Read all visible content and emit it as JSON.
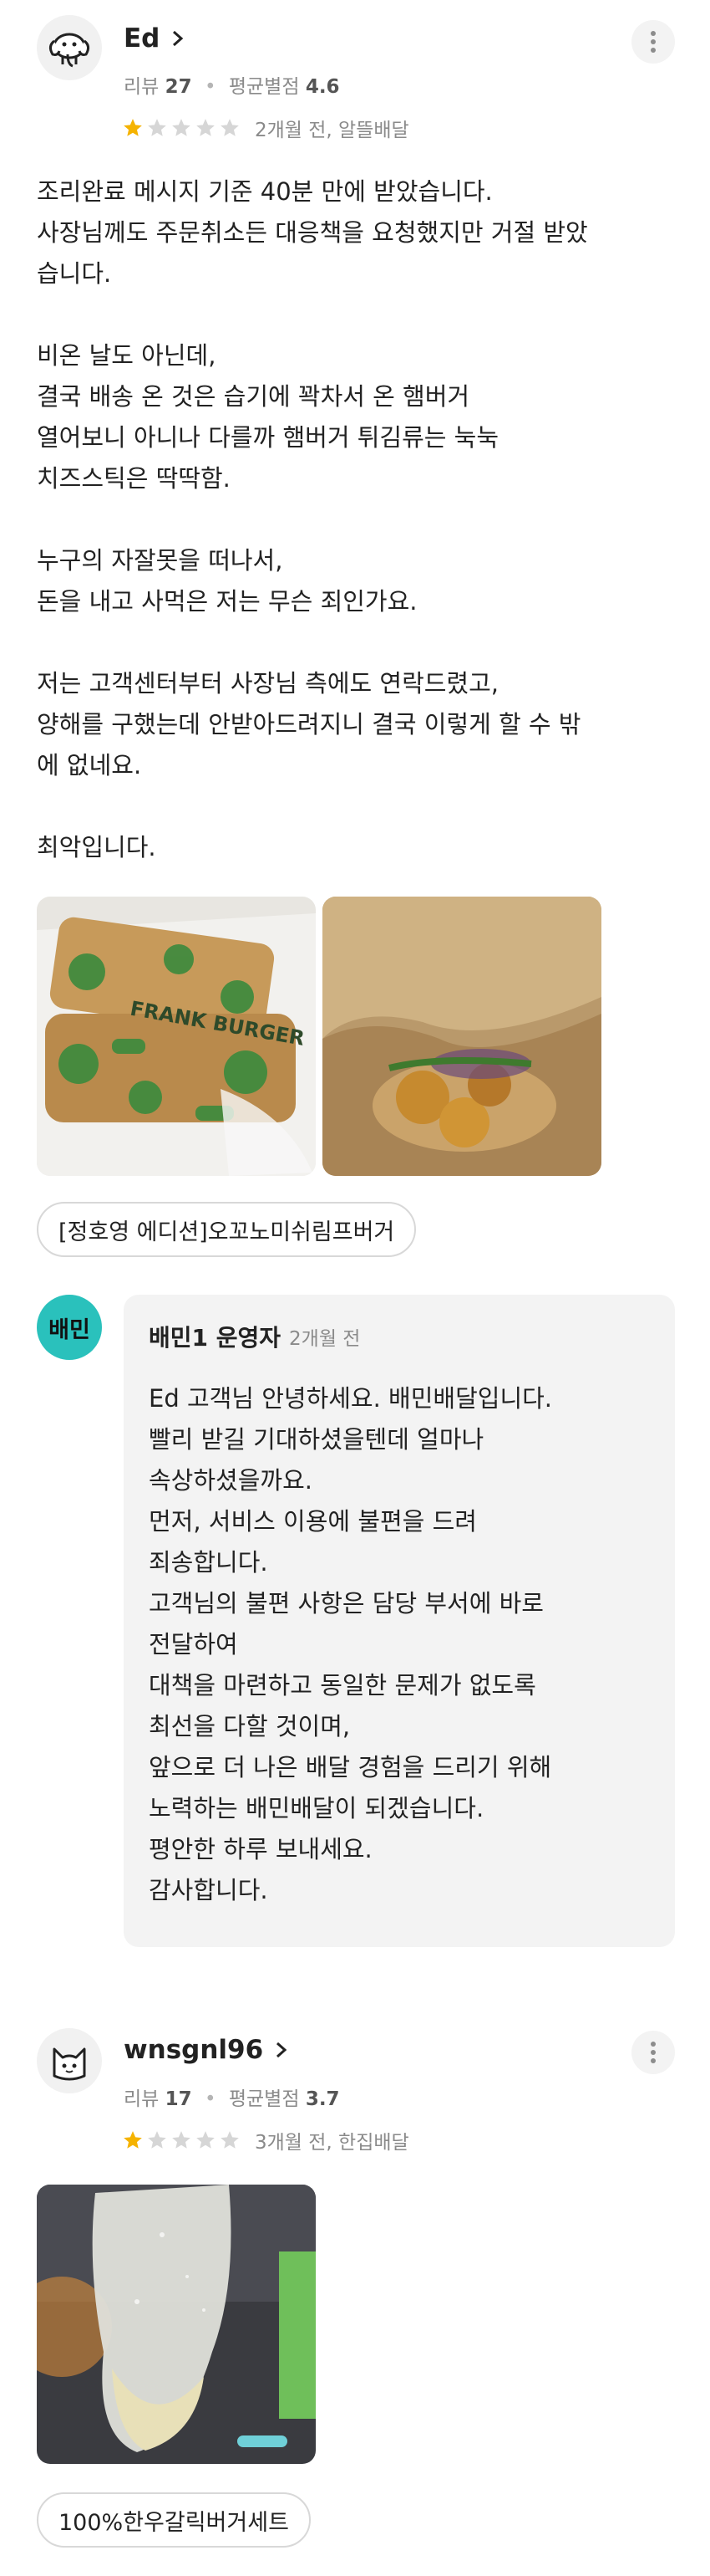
{
  "review1": {
    "username": "Ed",
    "review_label": "리뷰",
    "review_count": "27",
    "avg_label": "평균별점",
    "avg_rating": "4.6",
    "rating": 1,
    "date_info": "2개월 전, 알뜰배달",
    "text_lines": [
      "조리완료 메시지 기준 40분 만에 받았습니다.",
      "사장님께도 주문취소든 대응책을 요청했지만 거절 받았",
      "습니다.",
      "",
      "비온 날도 아닌데,",
      "결국 배송 온 것은 습기에 꽉차서 온 햄버거",
      "열어보니 아니나 다를까 햄버거 튀김류는 눅눅",
      "치즈스틱은 딱딱함.",
      "",
      "누구의 자잘못을 떠나서,",
      "돈을 내고 사먹은 저는 무슨 죄인가요.",
      "",
      "저는 고객센터부터 사장님 측에도 연락드렸고,",
      "양해를 구했는데 안받아드려지니 결국 이렇게 할 수 밖",
      "에 없네요.",
      "",
      "최악입니다."
    ],
    "photo1_text": "FRANK BURGER",
    "menu_chip": "[정호영 에디션]오꼬노미쉬림프버거"
  },
  "reply": {
    "logo_text": "배민",
    "owner_name": "배민1 운영자",
    "date": "2개월 전",
    "text_lines": [
      "Ed 고객님 안녕하세요. 배민배달입니다.",
      "빨리 받길 기대하셨을텐데 얼마나",
      "속상하셨을까요.",
      "먼저, 서비스 이용에 불편을 드려",
      "죄송합니다.",
      "고객님의 불편 사항은 담당 부서에 바로",
      "전달하여",
      "대책을 마련하고 동일한 문제가 없도록",
      "최선을 다할 것이며,",
      "앞으로 더 나은 배달 경험을 드리기 위해",
      "노력하는 배민배달이 되겠습니다.",
      "평안한 하루 보내세요.",
      "감사합니다."
    ]
  },
  "review2": {
    "username": "wnsgnl96",
    "review_label": "리뷰",
    "review_count": "17",
    "avg_label": "평균별점",
    "avg_rating": "3.7",
    "rating": 1,
    "date_info": "3개월 전, 한집배달",
    "menu_chip": "100%한우갈릭버거세트"
  },
  "colors": {
    "star_filled": "#f5b301",
    "star_empty": "#d6d6d6",
    "baemin_mint": "#2ac1bc",
    "reply_bg": "#f3f3f3"
  }
}
